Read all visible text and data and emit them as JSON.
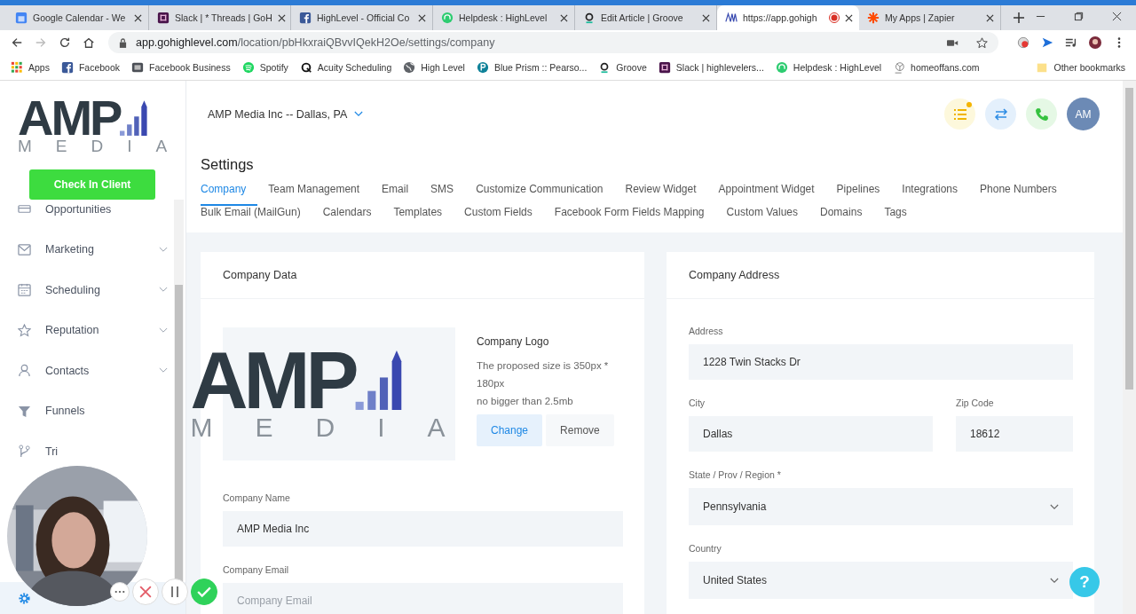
{
  "browser": {
    "tabs": [
      {
        "title": "Google Calendar - We",
        "selected": false
      },
      {
        "title": "Slack | * Threads | GoH",
        "selected": false
      },
      {
        "title": "HighLevel - Official Co",
        "selected": false
      },
      {
        "title": "Helpdesk : HighLevel",
        "selected": false
      },
      {
        "title": "Edit Article | Groove",
        "selected": false
      },
      {
        "title": "https://app.gohigh",
        "selected": true,
        "recording": true
      },
      {
        "title": "My Apps | Zapier",
        "selected": false
      }
    ],
    "url_host": "app.gohighlevel.com",
    "url_path": "/location/pbHkxraiQBvvIQekH2Oe/settings/company",
    "bookmarks": [
      "Apps",
      "Facebook",
      "Facebook Business",
      "Spotify",
      "Acuity Scheduling",
      "High Level",
      "Blue Prism :: Pearso...",
      "Groove",
      "Slack | highlevelers...",
      "Helpdesk : HighLevel",
      "homeoffans.com"
    ],
    "other_bookmarks": "Other bookmarks"
  },
  "logo": {
    "name": "AMP",
    "sub": "MEDIA"
  },
  "location": "AMP Media Inc -- Dallas, PA",
  "header": {
    "notification": true,
    "avatar": "AM"
  },
  "sidebar": {
    "check_in": "Check In Client",
    "items": [
      {
        "label": "Opportunities",
        "expandable": false
      },
      {
        "label": "Marketing",
        "expandable": true
      },
      {
        "label": "Scheduling",
        "expandable": true
      },
      {
        "label": "Reputation",
        "expandable": true
      },
      {
        "label": "Contacts",
        "expandable": true
      },
      {
        "label": "Funnels",
        "expandable": false
      },
      {
        "label": "Tri",
        "expandable": false
      }
    ]
  },
  "settings": {
    "title": "Settings",
    "tab_rows": [
      [
        {
          "label": "Company",
          "selected": true
        },
        {
          "label": "Team Management",
          "selected": false
        },
        {
          "label": "Email",
          "selected": false
        },
        {
          "label": "SMS",
          "selected": false
        },
        {
          "label": "Customize Communication",
          "selected": false
        },
        {
          "label": "Review Widget",
          "selected": false
        },
        {
          "label": "Appointment Widget",
          "selected": false
        },
        {
          "label": "Pipelines",
          "selected": false
        },
        {
          "label": "Integrations",
          "selected": false
        },
        {
          "label": "Phone Numbers",
          "selected": false
        }
      ],
      [
        {
          "label": "Bulk Email (MailGun)",
          "selected": false
        },
        {
          "label": "Calendars",
          "selected": false
        },
        {
          "label": "Templates",
          "selected": false
        },
        {
          "label": "Custom Fields",
          "selected": false
        },
        {
          "label": "Facebook Form Fields Mapping",
          "selected": false
        },
        {
          "label": "Custom Values",
          "selected": false
        },
        {
          "label": "Domains",
          "selected": false
        },
        {
          "label": "Tags",
          "selected": false
        }
      ]
    ]
  },
  "company_data": {
    "title": "Company Data",
    "logo": {
      "name": "AMP",
      "sub": "MEDIA"
    },
    "logo_label": "Company Logo",
    "logo_hint": [
      "The proposed size is 350px * 180px",
      "no bigger than 2.5mb"
    ],
    "change": "Change",
    "remove": "Remove",
    "fields": [
      {
        "label": "Company Name",
        "value": "AMP Media Inc"
      },
      {
        "label": "Company Email",
        "placeholder": "Company Email"
      }
    ]
  },
  "company_address": {
    "title": "Company Address",
    "rows": [
      [
        {
          "label": "Address",
          "value": "1228 Twin Stacks Dr",
          "kind": "text",
          "wide": true
        }
      ],
      [
        {
          "label": "City",
          "value": "Dallas",
          "kind": "text",
          "wide": true
        },
        {
          "label": "Zip Code",
          "value": "18612",
          "kind": "text",
          "wide": false
        }
      ],
      [
        {
          "label": "State / Prov / Region *",
          "value": "Pennsylvania",
          "kind": "select",
          "wide": true
        }
      ],
      [
        {
          "label": "Country",
          "value": "United States",
          "kind": "select",
          "wide": true
        }
      ]
    ]
  },
  "help": "?"
}
